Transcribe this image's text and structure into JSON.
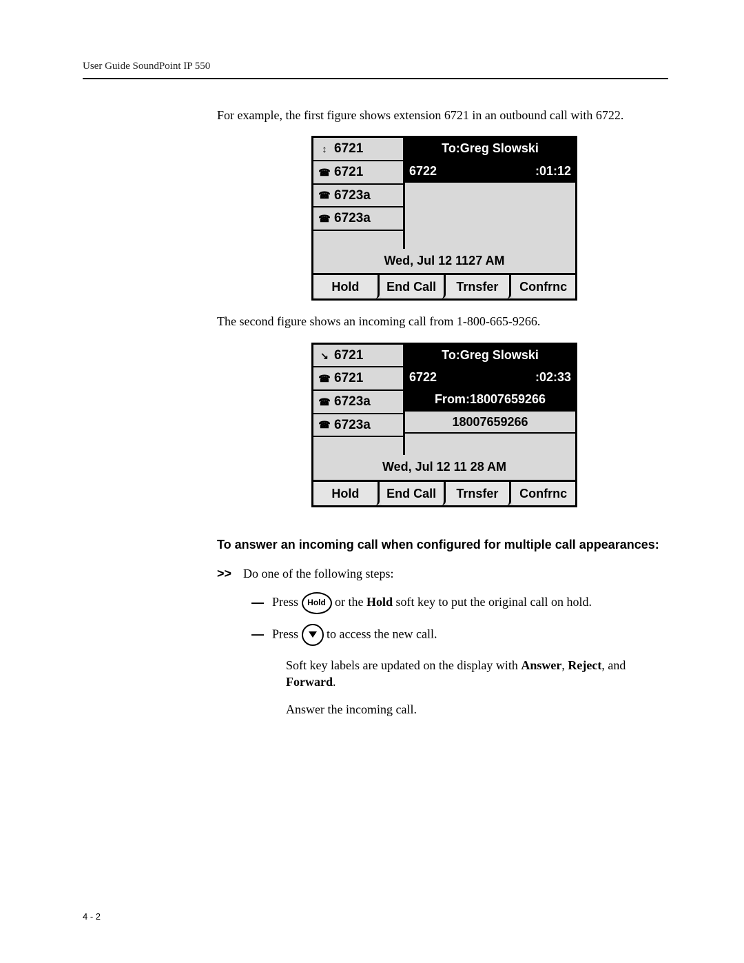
{
  "header": "User Guide SoundPoint IP 550",
  "intro1": "For example, the first figure shows extension 6721 in an outbound call with 6722.",
  "figure1": {
    "lines": [
      "6721",
      "6721",
      "6723a",
      "6723a"
    ],
    "icons": [
      "↕",
      "☎",
      "☎",
      "☎"
    ],
    "to": "To:Greg Slowski",
    "num": "6722",
    "timer": ":01:12",
    "datetime": "Wed, Jul 12  1127 AM",
    "softkeys": [
      "Hold",
      "End Call",
      "Trnsfer",
      "Confrnc"
    ]
  },
  "intro2": "The second figure shows an incoming call from 1-800-665-9266.",
  "figure2": {
    "lines": [
      "6721",
      "6721",
      "6723a",
      "6723a"
    ],
    "icons": [
      "↘",
      "☎",
      "☎",
      "☎"
    ],
    "to": "To:Greg Slowski",
    "num": "6722",
    "timer": ":02:33",
    "from": "From:18007659266",
    "caller": "18007659266",
    "datetime": "Wed, Jul 12  11 28 AM",
    "softkeys": [
      "Hold",
      "End Call",
      "Trnsfer",
      "Confrnc"
    ]
  },
  "sectionHead": "To answer an incoming call when configured for multiple call appearances:",
  "stepMarker": ">>",
  "stepText": "Do one of the following steps:",
  "sub1_a": "Press",
  "holdKey": "Hold",
  "sub1_b": " or the ",
  "sub1_bold": "Hold",
  "sub1_c": " soft key to put the original call on hold.",
  "sub2_a": "Press",
  "sub2_b": " to access the new call.",
  "softkeyNote_a": "Soft key labels are updated on the display with ",
  "skn_answer": "Answer",
  "skn_sep1": ", ",
  "skn_reject": "Reject",
  "skn_sep2": ", and ",
  "skn_forward": "Forward",
  "skn_end": ".",
  "answerLine": "Answer the incoming call.",
  "footer": "4 - 2"
}
